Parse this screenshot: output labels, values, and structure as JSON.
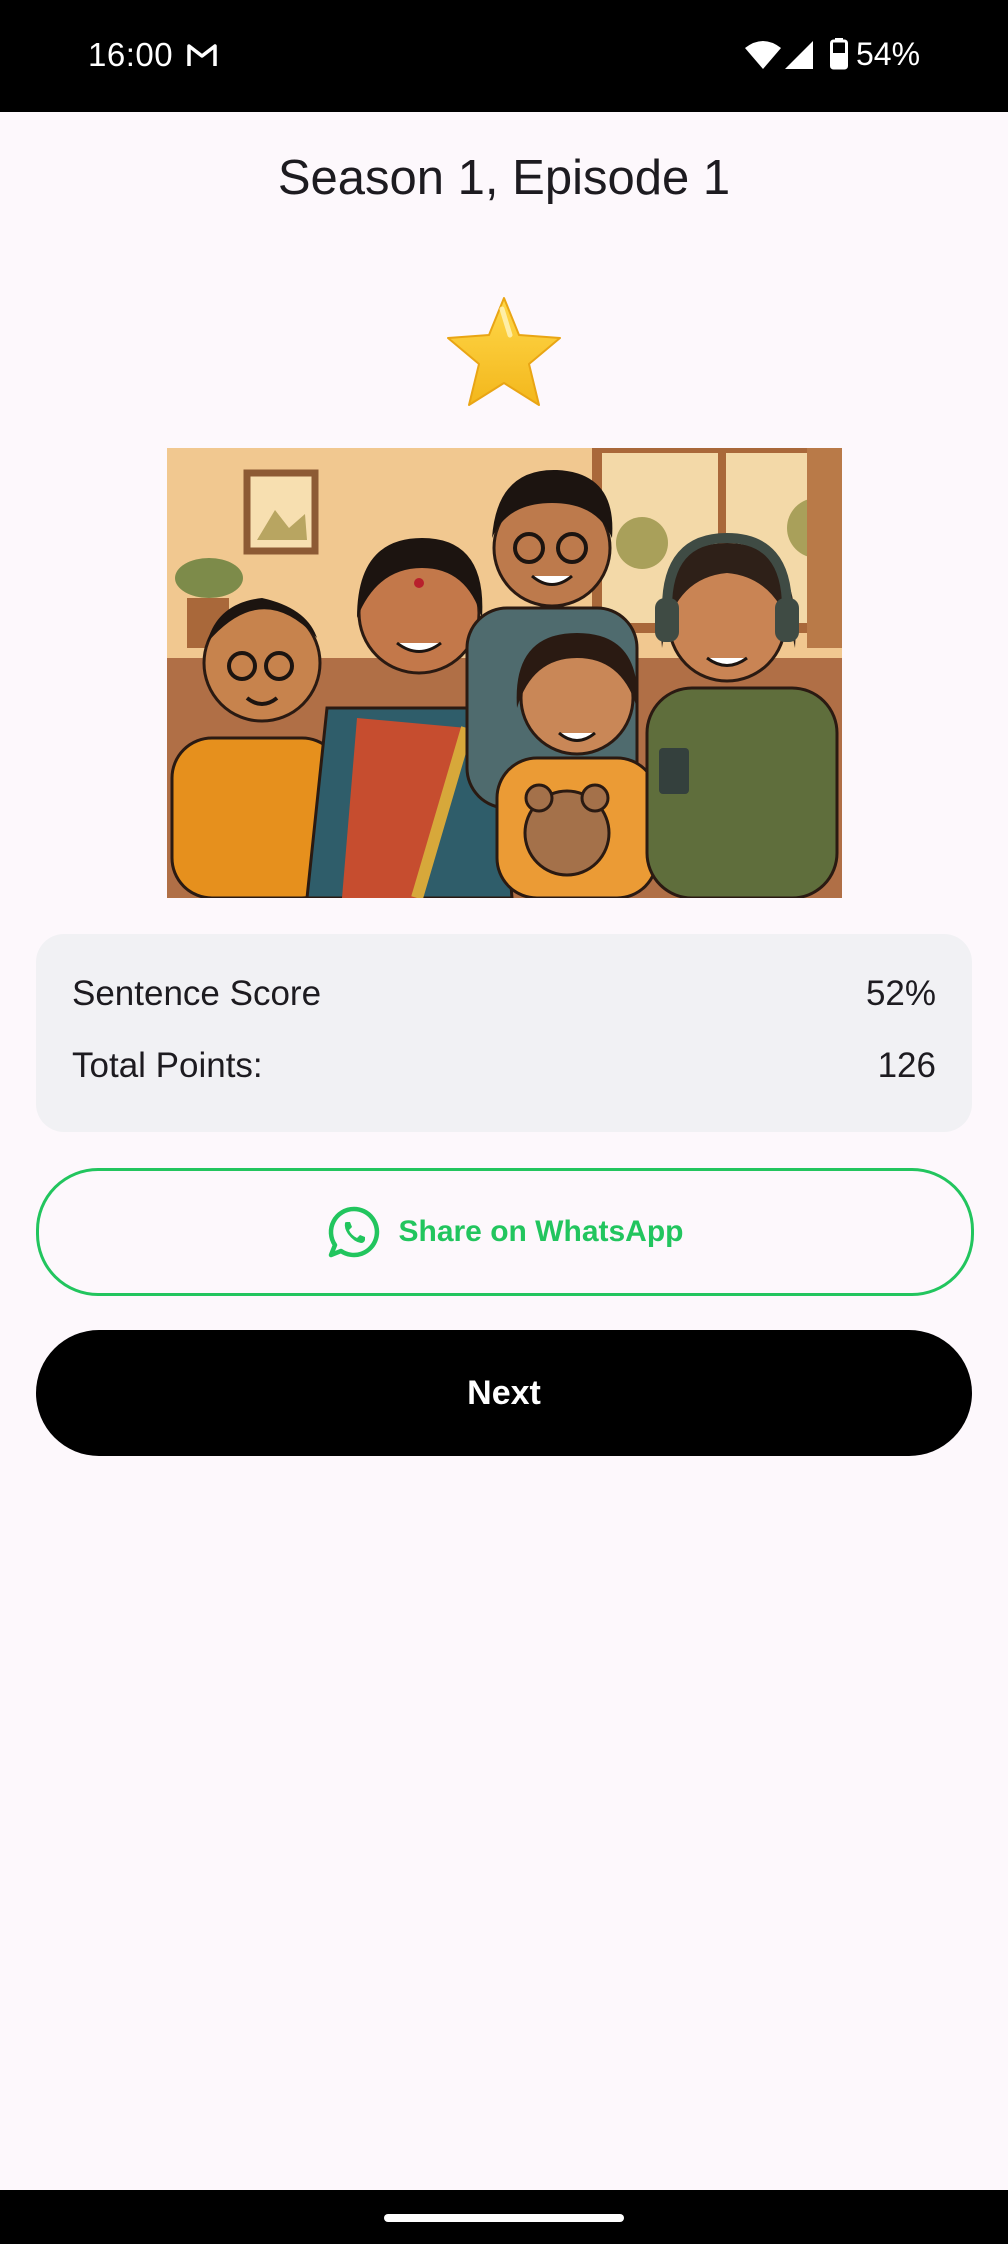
{
  "status_bar": {
    "time": "16:00",
    "battery": "54%",
    "icons": [
      "gmail-icon",
      "wifi-icon",
      "signal-icon",
      "battery-icon"
    ]
  },
  "header": {
    "title": "Season 1, Episode 1"
  },
  "rating": {
    "icon": "star-icon",
    "stars": 1,
    "color": "#f7c531"
  },
  "illustration": {
    "icon": "family-illustration"
  },
  "score_card": {
    "sentence_score_label": "Sentence Score",
    "sentence_score_value": "52%",
    "total_points_label": "Total Points:",
    "total_points_value": "126"
  },
  "actions": {
    "share_label": "Share on WhatsApp",
    "share_icon": "whatsapp-icon",
    "share_color": "#22c55e",
    "next_label": "Next"
  }
}
